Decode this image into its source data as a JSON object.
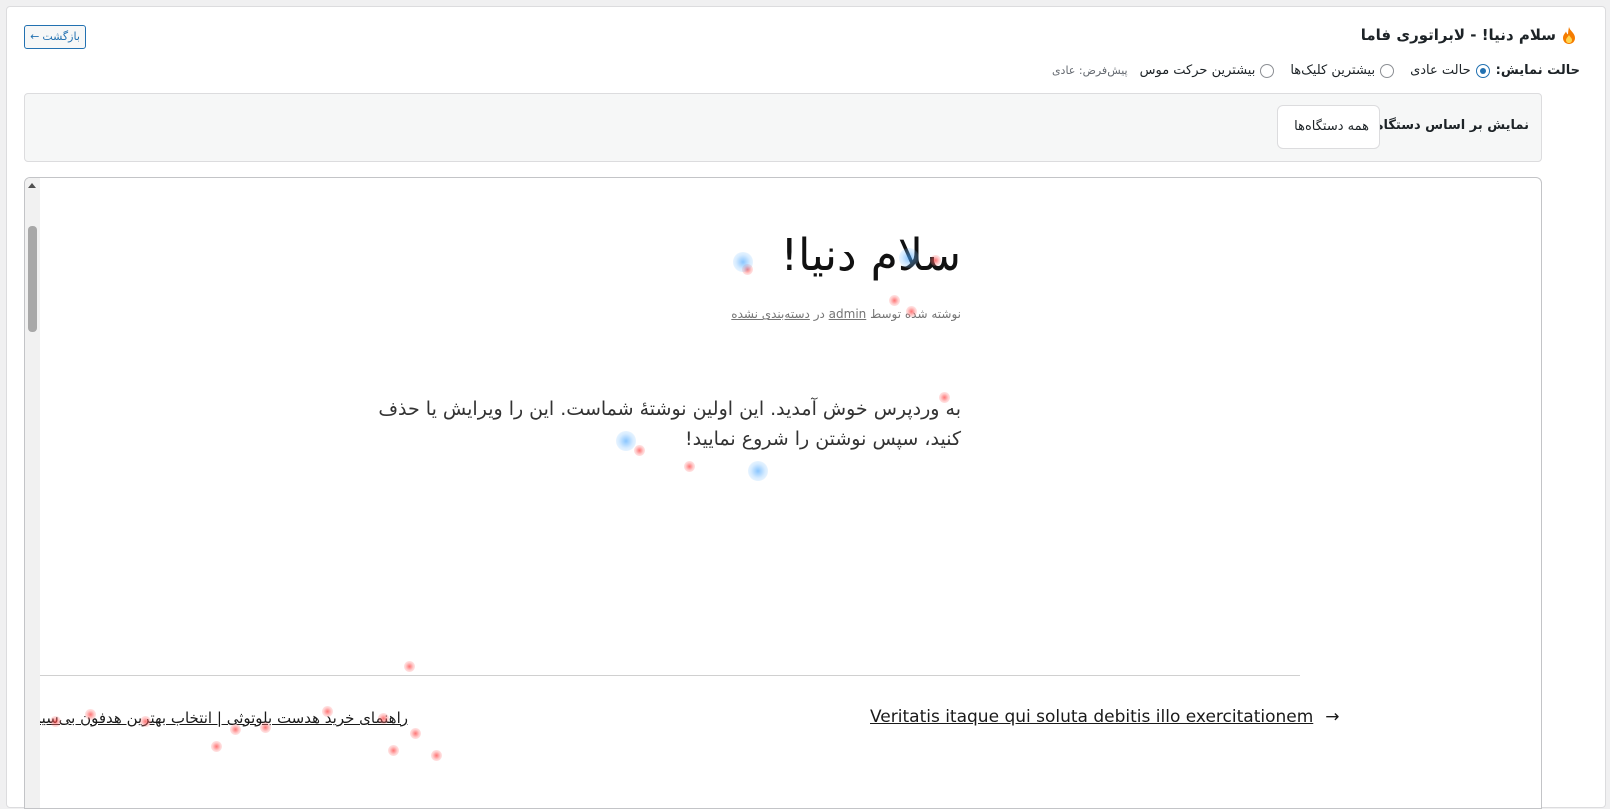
{
  "header": {
    "title": "سلام دنیا! - لابراتوری فاما",
    "title_icon": "flame-icon",
    "back_button_label": "بازگشت",
    "back_button_icon": "arrow-left-icon"
  },
  "display_mode": {
    "label": "حالت نمایش:",
    "options": [
      {
        "label": "حالت عادی",
        "selected": true
      },
      {
        "label": "بیشترین کلیک‌ها",
        "selected": false
      },
      {
        "label": "بیشترین حرکت موس",
        "selected": false
      }
    ],
    "hint": "پیش‌فرض: عادی"
  },
  "device_filter": {
    "label": "نمایش بر اساس دستگاه:",
    "selected": "همه دستگاه‌ها"
  },
  "post": {
    "title": "سلام دنیا!",
    "meta_written_by": "نوشته شده توسط",
    "meta_author": "admin",
    "meta_in": "در",
    "meta_category": "دسته‌بندی نشده",
    "content": "به وردپرس خوش آمدید. این اولین نوشتهٔ شماست. این را ویرایش یا حذف کنید، سپس نوشتن را شروع نمایید!"
  },
  "post_nav": {
    "next_title": "Veritatis itaque qui soluta debitis illo exercitationem",
    "next_arrow": "→",
    "prev_title": "راهنمای خرید هدست بلوتوثی | انتخاب بهترین هدفون بی‌سیم"
  },
  "colors": {
    "accent": "#2271b1",
    "heat_click": "#ff4646",
    "heat_move": "#3ca0ff"
  }
}
